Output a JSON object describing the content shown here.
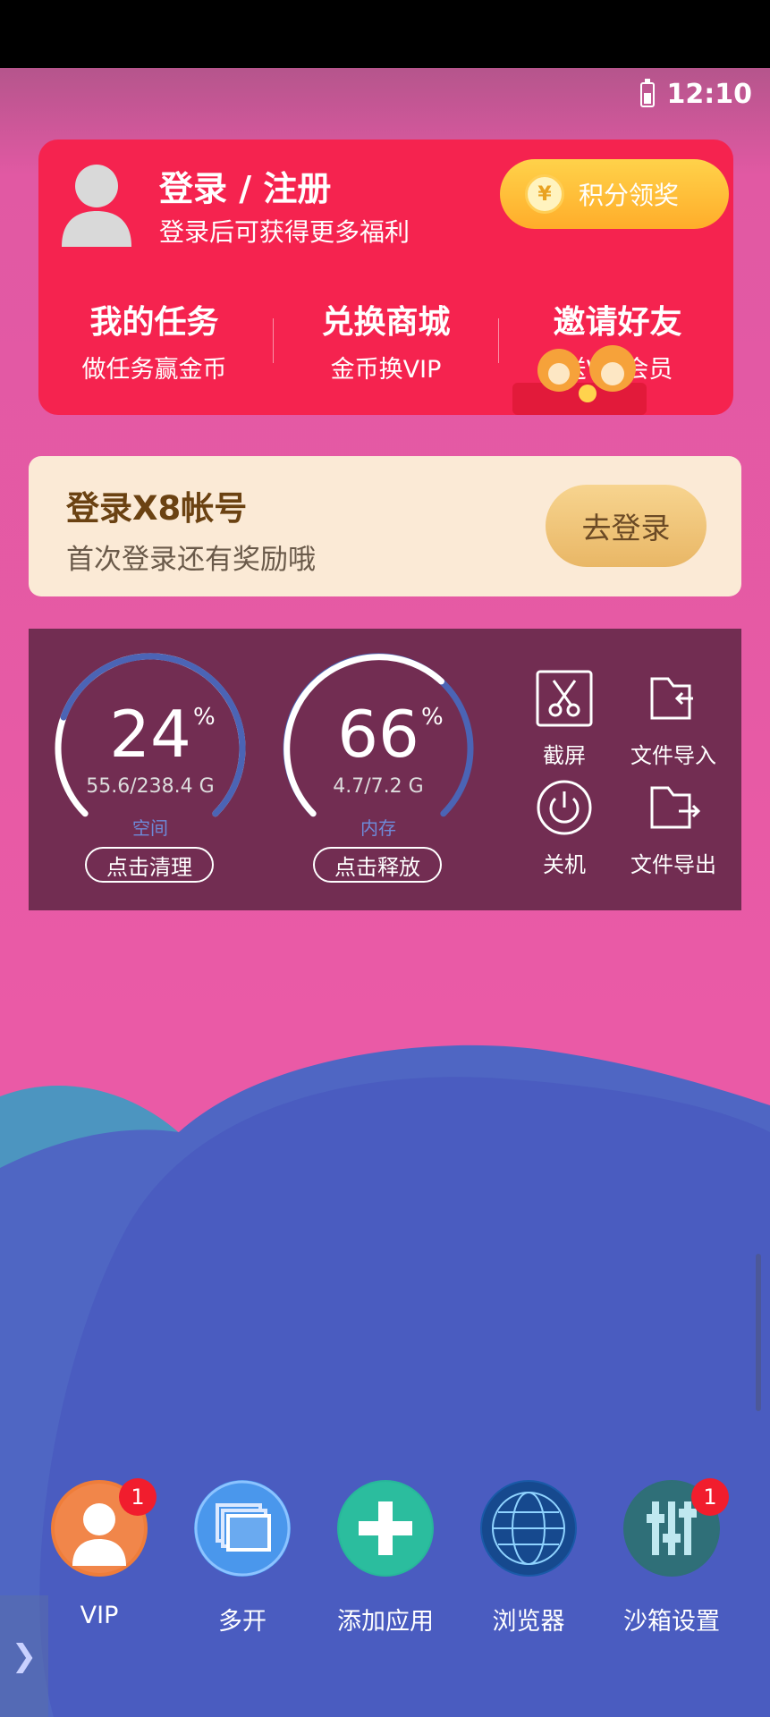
{
  "status": {
    "time": "12:10"
  },
  "account_card": {
    "title": "登录 / 注册",
    "subtitle": "登录后可获得更多福利",
    "points_button": "积分领奖",
    "coin_symbol": "¥",
    "menu": [
      {
        "title": "我的任务",
        "sub": "做任务赢金币"
      },
      {
        "title": "兑换商城",
        "sub": "金币换VIP"
      },
      {
        "title": "邀请好友",
        "sub": "送VIP会员"
      }
    ]
  },
  "x8_card": {
    "title": "登录X8帐号",
    "subtitle": "首次登录还有奖励哦",
    "button": "去登录"
  },
  "tools_panel": {
    "storage": {
      "value": "24",
      "unit": "%",
      "detail": "55.6/238.4 G",
      "label": "空间",
      "button": "点击清理",
      "fraction": 0.24
    },
    "memory": {
      "value": "66",
      "unit": "%",
      "detail": "4.7/7.2 G",
      "label": "内存",
      "button": "点击释放",
      "fraction": 0.66
    },
    "tools": [
      {
        "icon": "scissors-icon",
        "label": "截屏"
      },
      {
        "icon": "folder-import-icon",
        "label": "文件导入"
      },
      {
        "icon": "power-icon",
        "label": "关机"
      },
      {
        "icon": "folder-export-icon",
        "label": "文件导出"
      }
    ]
  },
  "dock": [
    {
      "label": "VIP",
      "icon": "vip-avatar-icon",
      "badge": "1",
      "color": "#ef7d3a"
    },
    {
      "label": "多开",
      "icon": "multi-window-icon",
      "color": "#3f8fe8"
    },
    {
      "label": "添加应用",
      "icon": "add-app-icon",
      "color": "#27b79a"
    },
    {
      "label": "浏览器",
      "icon": "globe-icon",
      "color": "#1a5aa8"
    },
    {
      "label": "沙箱设置",
      "icon": "sliders-icon",
      "badge": "1",
      "color": "#2f6f78"
    }
  ],
  "edge_tab": {
    "glyph": "❯"
  }
}
